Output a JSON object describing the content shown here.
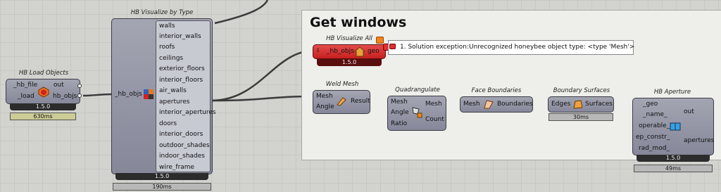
{
  "group": {
    "title": "Get windows"
  },
  "hb_load": {
    "title": "HB Load Objects",
    "inputs": [
      "_hb_file",
      "_load"
    ],
    "outputs": [
      "out",
      "hb_objs"
    ],
    "version": "1.5.0",
    "timer": "630ms"
  },
  "hb_visualize_type": {
    "title": "HB Visualize by Type",
    "input": "_hb_objs",
    "outputs": [
      "walls",
      "interior_walls",
      "roofs",
      "ceilings",
      "exterior_floors",
      "interior_floors",
      "air_walls",
      "apertures",
      "interior_apertures",
      "doors",
      "interior_doors",
      "outdoor_shades",
      "indoor_shades",
      "wire_frame"
    ],
    "version": "1.5.0",
    "timer": "190ms"
  },
  "hb_visualize_all": {
    "title": "HB Visualize All",
    "input": "_hb_objs",
    "output": "geo",
    "version": "1.5.0"
  },
  "error_popup": {
    "message": "1. Solution exception:Unrecognized honeybee object type: <type 'Mesh'>"
  },
  "weld_mesh": {
    "title": "Weld Mesh",
    "inputs": [
      "Mesh",
      "Angle"
    ],
    "output": "Result"
  },
  "quadrangulate": {
    "title": "Quadrangulate",
    "inputs": [
      "Mesh",
      "Angle",
      "Ratio"
    ],
    "outputs": [
      "Mesh",
      "Count"
    ]
  },
  "face_boundaries": {
    "title": "Face Boundaries",
    "input": "Mesh",
    "output": "Boundaries"
  },
  "boundary_surfaces": {
    "title": "Boundary Surfaces",
    "input": "Edges",
    "output": "Surfaces",
    "timer": "30ms"
  },
  "hb_aperture": {
    "title": "HB Aperture",
    "inputs": [
      "_geo",
      "_name_",
      "operable_",
      "ep_constr_",
      "rad_mod_"
    ],
    "outputs": [
      "out",
      "apertures"
    ],
    "version": "1.5.0",
    "timer": "49ms"
  },
  "colors": {
    "component": "#9a9cab",
    "error": "#d63030",
    "timer_yellow": "#cccc96",
    "canvas": "#d2d2cf"
  }
}
